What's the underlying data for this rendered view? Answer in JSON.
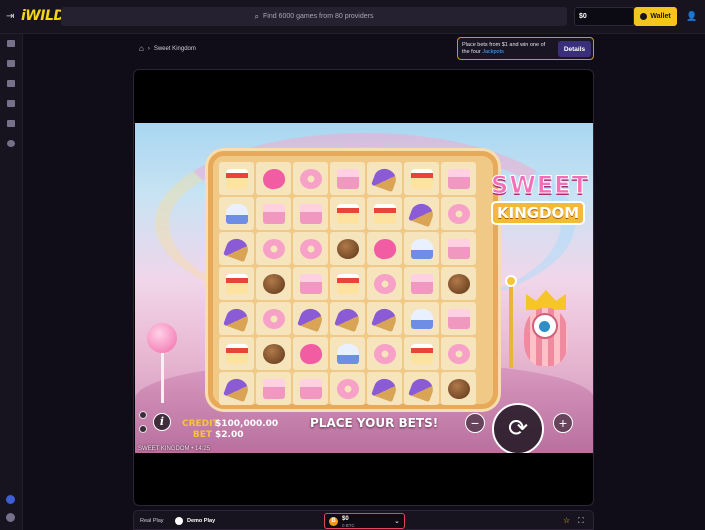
{
  "header": {
    "logo": "iWILD",
    "search_placeholder": "Find 6000 games from 80 providers",
    "balance": "$0",
    "wallet_label": "Wallet"
  },
  "breadcrumb": {
    "current": "Sweet Kingdom"
  },
  "jackpot_banner": {
    "text_before": "Place bets from $1 and win one of the four",
    "highlight": "Jackpots",
    "details_label": "Details"
  },
  "game": {
    "logo_line1": "SWEET",
    "logo_line2": "KINGDOM",
    "credit_label": "CREDIT",
    "credit_value": "$100,000.00",
    "bet_label": "BET",
    "bet_value": "$2.00",
    "message": "PLACE YOUR BETS!",
    "footer": "SWEET KINGDOM • 14:25",
    "grid": [
      [
        "cake",
        "heart",
        "donut",
        "bar",
        "cone",
        "cake",
        "bar"
      ],
      [
        "cup",
        "bar",
        "bar",
        "cake",
        "cake",
        "cone",
        "donut"
      ],
      [
        "cone",
        "donut",
        "donut",
        "choc",
        "heart",
        "cup",
        "bar"
      ],
      [
        "cake",
        "choc",
        "bar",
        "cake",
        "donut",
        "bar",
        "choc"
      ],
      [
        "cone",
        "donut",
        "cone",
        "cone",
        "cone",
        "cup",
        "bar"
      ],
      [
        "cake",
        "choc",
        "heart",
        "cup",
        "donut",
        "cake",
        "donut"
      ],
      [
        "cone",
        "bar",
        "bar",
        "donut",
        "cone",
        "cone",
        "choc"
      ]
    ]
  },
  "footer_bar": {
    "real_play": "Real Play",
    "demo_play": "Demo Play",
    "currency_amount": "$0",
    "currency_sub": "0 BTC"
  },
  "colors": {
    "accent": "#f4c51c",
    "background": "#110d18",
    "jackpot_link": "#47a7ff"
  },
  "icons": [
    "collapse-icon",
    "search-icon",
    "wallet-icon",
    "user-icon",
    "home-icon",
    "info-icon",
    "spin-icon",
    "star-icon",
    "fullscreen-icon"
  ]
}
